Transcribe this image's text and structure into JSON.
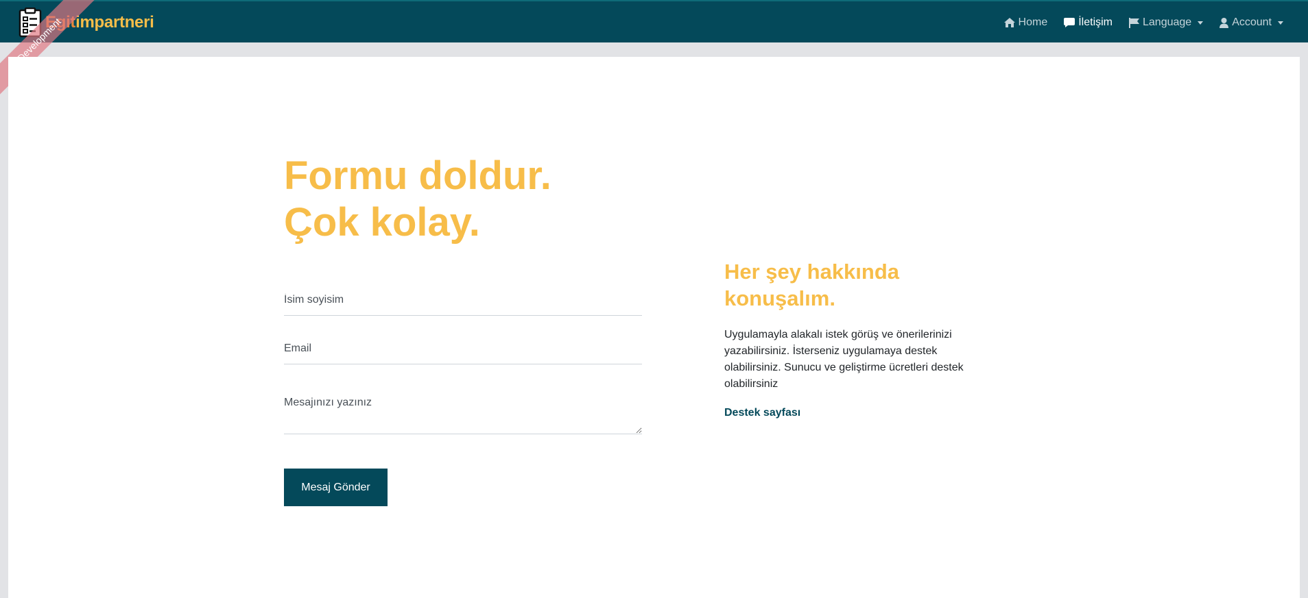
{
  "brand": {
    "prefix": "Egit",
    "name": "impartneri",
    "logo_icon": "clipboard-checklist-icon"
  },
  "environment_ribbon": "Development",
  "nav": {
    "home": {
      "label": "Home",
      "icon": "home-icon"
    },
    "contact": {
      "label": "İletişim",
      "icon": "chat-bubble-icon"
    },
    "language": {
      "label": "Language",
      "icon": "flag-icon"
    },
    "account": {
      "label": "Account",
      "icon": "user-icon"
    }
  },
  "hero": {
    "line1": "Formu doldur.",
    "line2": "Çok kolay."
  },
  "form": {
    "name_placeholder": "İsim soyisim",
    "email_placeholder": "Email",
    "message_placeholder": "Mesajınızı yazınız",
    "submit_label": "Mesaj Gönder"
  },
  "side": {
    "title_line1": "Her şey hakkında",
    "title_line2": "konuşalım.",
    "description": "Uygulamayla alakalı istek görüş ve önerilerinizi yazabilirsiniz. İsterseniz uygulamaya destek olabilirsiniz. Sunucu ve geliştirme ücretleri destek olabilirsiniz",
    "link_label": "Destek sayfası"
  },
  "colors": {
    "navbar": "#04495a",
    "accent": "#f7bd49",
    "button": "#04495a"
  }
}
